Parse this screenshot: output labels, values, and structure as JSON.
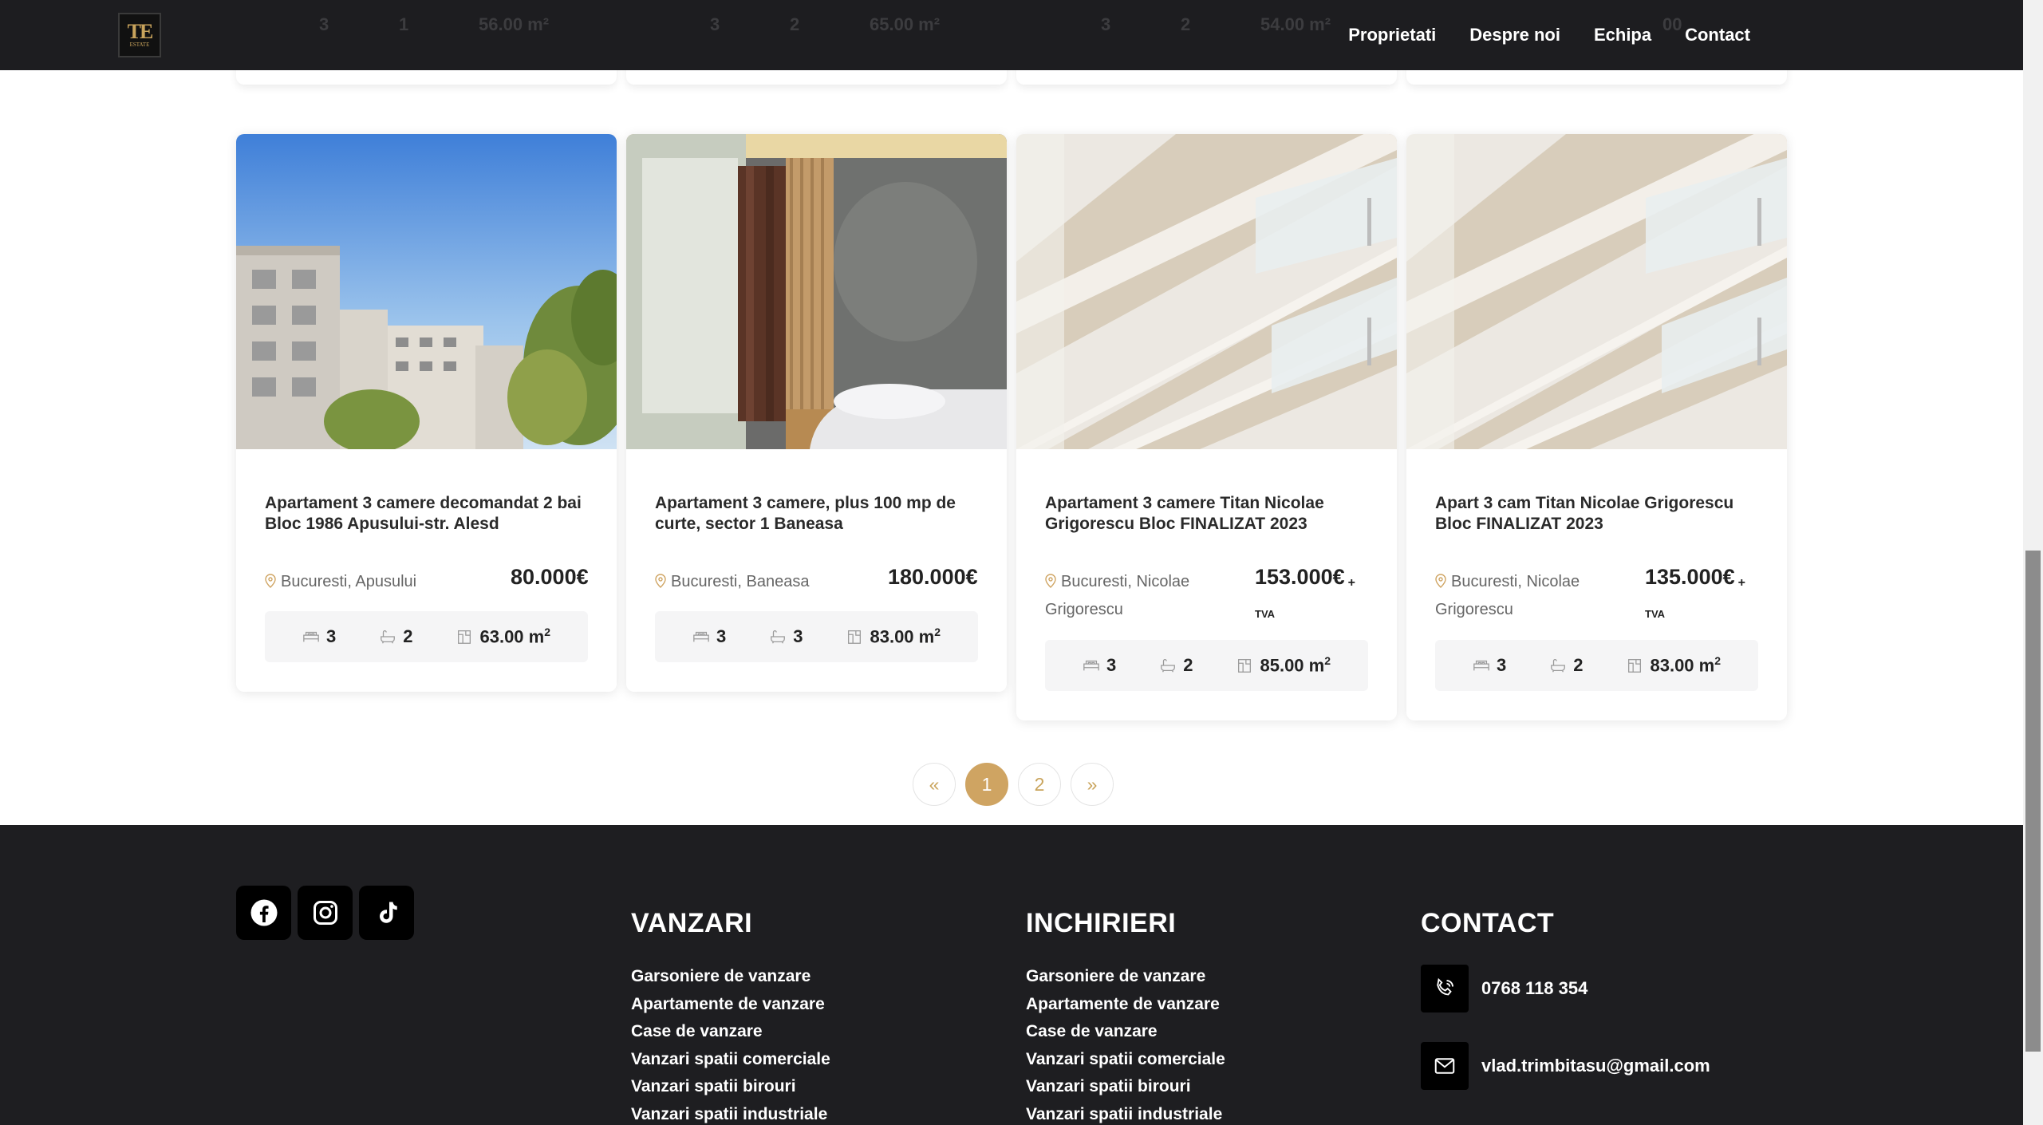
{
  "nav": {
    "links": [
      "Proprietati",
      "Despre noi",
      "Echipa",
      "Contact"
    ],
    "logo": {
      "mono": "TE",
      "sub": "ESTATE"
    }
  },
  "prev_row": [
    {
      "beds": "3",
      "baths": "1",
      "area": "56.00 m²"
    },
    {
      "beds": "3",
      "baths": "2",
      "area": "65.00 m²"
    },
    {
      "beds": "3",
      "baths": "2",
      "area": "54.00 m²"
    },
    {
      "beds": "",
      "baths": "",
      "area": "00"
    }
  ],
  "listings": [
    {
      "title": "Apartament 3 camere decomandat 2 bai Bloc 1986 Apusului-str. Alesd",
      "location": "Bucuresti, Apusului",
      "price": "80.000€",
      "plus": "",
      "tva": "",
      "beds": "3",
      "baths": "2",
      "area": "63.00 m",
      "area_sup": "2"
    },
    {
      "title": "Apartament 3 camere, plus 100 mp de curte, sector 1 Baneasa",
      "location": "Bucuresti, Baneasa",
      "price": "180.000€",
      "plus": "",
      "tva": "",
      "beds": "3",
      "baths": "3",
      "area": "83.00 m",
      "area_sup": "2"
    },
    {
      "title": "Apartament 3 camere Titan Nicolae Grigorescu Bloc FINALIZAT 2023",
      "location": "Bucuresti, Nicolae Grigorescu",
      "price": "153.000€",
      "plus": "+",
      "tva": "TVA",
      "beds": "3",
      "baths": "2",
      "area": "85.00 m",
      "area_sup": "2"
    },
    {
      "title": "Apart 3 cam Titan Nicolae Grigorescu Bloc FINALIZAT 2023",
      "location": "Bucuresti, Nicolae Grigorescu",
      "price": "135.000€",
      "plus": "+",
      "tva": "TVA",
      "beds": "3",
      "baths": "2",
      "area": "83.00 m",
      "area_sup": "2"
    }
  ],
  "pagination": {
    "prev": "«",
    "pages": [
      "1",
      "2"
    ],
    "active": "1",
    "next": "»"
  },
  "footer": {
    "vanzari": {
      "heading": "VANZARI",
      "links": [
        "Garsoniere de vanzare",
        "Apartamente de vanzare",
        "Case de vanzare",
        "Vanzari spatii comerciale",
        "Vanzari spatii birouri",
        "Vanzari spatii industriale"
      ]
    },
    "inchirieri": {
      "heading": "INCHIRIERI",
      "links": [
        "Garsoniere de vanzare",
        "Apartamente de vanzare",
        "Case de vanzare",
        "Vanzari spatii comerciale",
        "Vanzari spatii birouri",
        "Vanzari spatii industriale"
      ]
    },
    "contact": {
      "heading": "CONTACT",
      "phone": "0768 118 354",
      "email": "vlad.trimbitasu@gmail.com"
    },
    "social": [
      "facebook-icon",
      "instagram-icon",
      "tiktok-icon"
    ]
  },
  "colors": {
    "accent": "#cfa462",
    "nav_bg": "#1d1d20",
    "footer_bg": "#1e1e21"
  }
}
